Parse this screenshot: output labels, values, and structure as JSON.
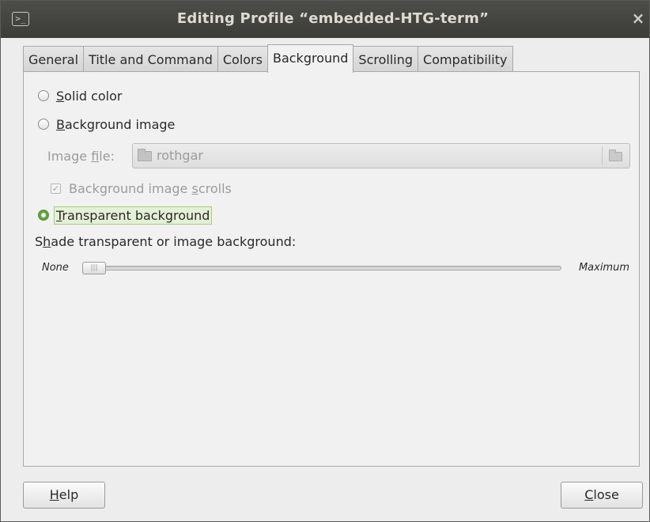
{
  "window": {
    "title": "Editing Profile “embedded-HTG-term”",
    "icon": "terminal-icon",
    "close_glyph": "×"
  },
  "tabs": [
    {
      "label": "General",
      "active": false
    },
    {
      "label": "Title and Command",
      "active": false
    },
    {
      "label": "Colors",
      "active": false
    },
    {
      "label": "Background",
      "active": true
    },
    {
      "label": "Scrolling",
      "active": false
    },
    {
      "label": "Compatibility",
      "active": false
    }
  ],
  "background": {
    "solid_color": {
      "mnemonic": "S",
      "rest": "olid color",
      "checked": false
    },
    "background_image": {
      "mnemonic": "B",
      "rest": "ackground image",
      "checked": false
    },
    "image_file": {
      "pre": "Image ",
      "mnemonic": "f",
      "post": "ile:",
      "value": "rothgar",
      "enabled": false
    },
    "image_scrolls": {
      "pre": "Background image ",
      "mnemonic": "s",
      "post": "crolls",
      "checked": true,
      "enabled": false
    },
    "transparent": {
      "mnemonic": "T",
      "rest": "ransparent background",
      "checked": true
    },
    "shade": {
      "pre": "S",
      "mnemonic": "h",
      "post": "ade transparent or image background:",
      "min_label": "None",
      "max_label": "Maximum",
      "value": 0.0
    }
  },
  "buttons": {
    "help": {
      "mnemonic": "H",
      "rest": "elp"
    },
    "close": {
      "mnemonic": "C",
      "rest": "lose"
    }
  },
  "colors": {
    "titlebar": "#3c3c39",
    "accent_green": "#6fb24a",
    "disabled_text": "#9b9b9b"
  }
}
